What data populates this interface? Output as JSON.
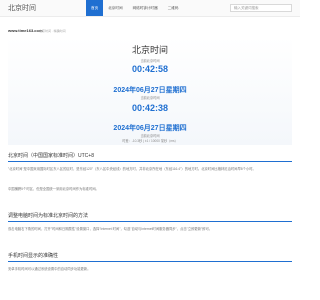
{
  "header": {
    "logo": "北京时间",
    "nav": [
      "首页",
      "北京时间",
      "网络时钟计时器",
      "二维码"
    ],
    "search_placeholder": "输入关键词搜索"
  },
  "site": {
    "domain": "www.time163.com",
    "domain_note": "北京时间 · 精确时间"
  },
  "clock": {
    "title": "北京时间",
    "label_1": "当前北京时间",
    "time_1": "00:42:58",
    "date_1": "2024年06月27日星期四",
    "label_2": "当前北京时间",
    "time_2": "00:42:38",
    "date_2": "2024年06月27日星期四",
    "label_3": "当前北京时间",
    "footer": "时差：-10.3秒  |  ±1 / 10000 毫秒（ms）"
  },
  "sections": {
    "s1_title": "北京时间（中国国家标准时间）UTC+8",
    "s1_p1": "\"北京时间\"是中国采用国际时区东八区的区时，是东经120°（东八区中央经线）的地方时，并非北京所在地（东经116.4°）的地方时。北京时间比格林尼治时间早8个小时。",
    "s1_p2": "中国横跨5个时区，但是全国统一采用北京时间作为标准时间。",
    "s2_title": "调整电脑时间为标准北京时间的方法",
    "s2_p1": "双击电脑右下角的时间，打开\"时间和日期属性\"设置窗口，选择\"Internet 时间\"，勾选\"自动与Internet时间服务器同步\"，点击\"立即更新\"即可。",
    "s3_title": "手机时间显示的准确性",
    "s3_p1": "安卓手机时间可以通过系统设置中的自动同步功能更新。"
  }
}
